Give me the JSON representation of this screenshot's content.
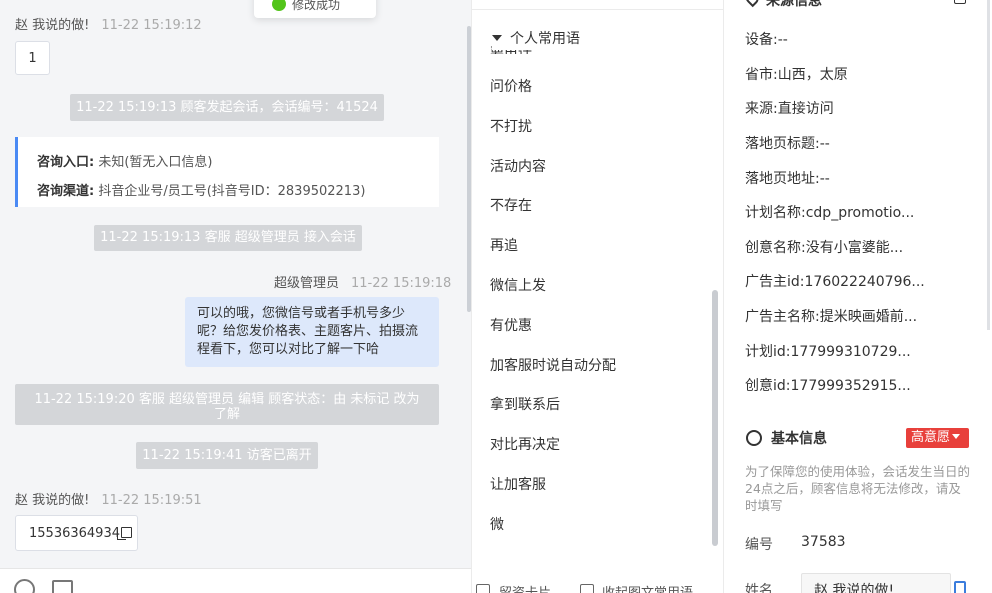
{
  "toast": {
    "text": "修改成功"
  },
  "chat": {
    "messages": [
      {
        "sender": "赵 我说的做!",
        "time": "11-22 15:19:12",
        "text": "1"
      },
      {
        "system": "11-22 15:19:13 顾客发起会话，会话编号：41524"
      },
      {
        "entry_label": "咨询入口:",
        "entry_value": "未知(暂无入口信息)",
        "channel_label": "咨询渠道:",
        "channel_value": "抖音企业号/员工号(抖音号ID：2839502213)"
      },
      {
        "system": "11-22 15:19:13 客服 超级管理员 接入会话"
      },
      {
        "sender": "超级管理员",
        "time": "11-22 15:19:18",
        "text": "可以的哦，您微信号或者手机号多少呢？给您发价格表、主题客片、拍摄流程看下，您可以对比了解一下哈"
      },
      {
        "system": "11-22 15:19:20 客服 超级管理员 编辑 顾客状态：由 未标记 改为 了解"
      },
      {
        "system": "11-22 15:19:41 访客已离开"
      },
      {
        "sender": "赵 我说的做!",
        "time": "11-22 15:19:51",
        "text": "15536364934"
      }
    ]
  },
  "phrases": {
    "header": "个人常用语",
    "cut_item": "要电话",
    "items": [
      "问价格",
      "不打扰",
      "活动内容",
      "不存在",
      "再追",
      "微信上发",
      "有优惠",
      "加客服时说自动分配",
      "拿到联系后",
      "对比再决定",
      "让加客服",
      "微"
    ],
    "footer_left": "留资卡片",
    "footer_right": "收起图文常用语"
  },
  "info": {
    "source_title": "来源信息",
    "source_fields": [
      {
        "label": "设备:",
        "value": "--"
      },
      {
        "label": "省市:",
        "value": "山西，太原"
      },
      {
        "label": "来源:",
        "value": "直接访问"
      },
      {
        "label": "落地页标题:",
        "value": "--"
      },
      {
        "label": "落地页地址:",
        "value": "--"
      },
      {
        "label": "计划名称:",
        "value": "cdp_promotio..."
      },
      {
        "label": "创意名称:",
        "value": "没有小富婆能..."
      },
      {
        "label": "广告主id:",
        "value": "176022240796..."
      },
      {
        "label": "广告主名称:",
        "value": "提米映画婚前..."
      },
      {
        "label": "计划id:",
        "value": "177999310729..."
      },
      {
        "label": "创意id:",
        "value": "177999352915..."
      }
    ],
    "basic_title": "基本信息",
    "intent_badge": "高意愿",
    "notice": "为了保障您的使用体验，会话发生当日的24点之后，顾客信息将无法修改，请及时填写",
    "id_label": "编号",
    "id_value": "37583",
    "name_label": "姓名",
    "name_value": "赵 我说的做!"
  }
}
